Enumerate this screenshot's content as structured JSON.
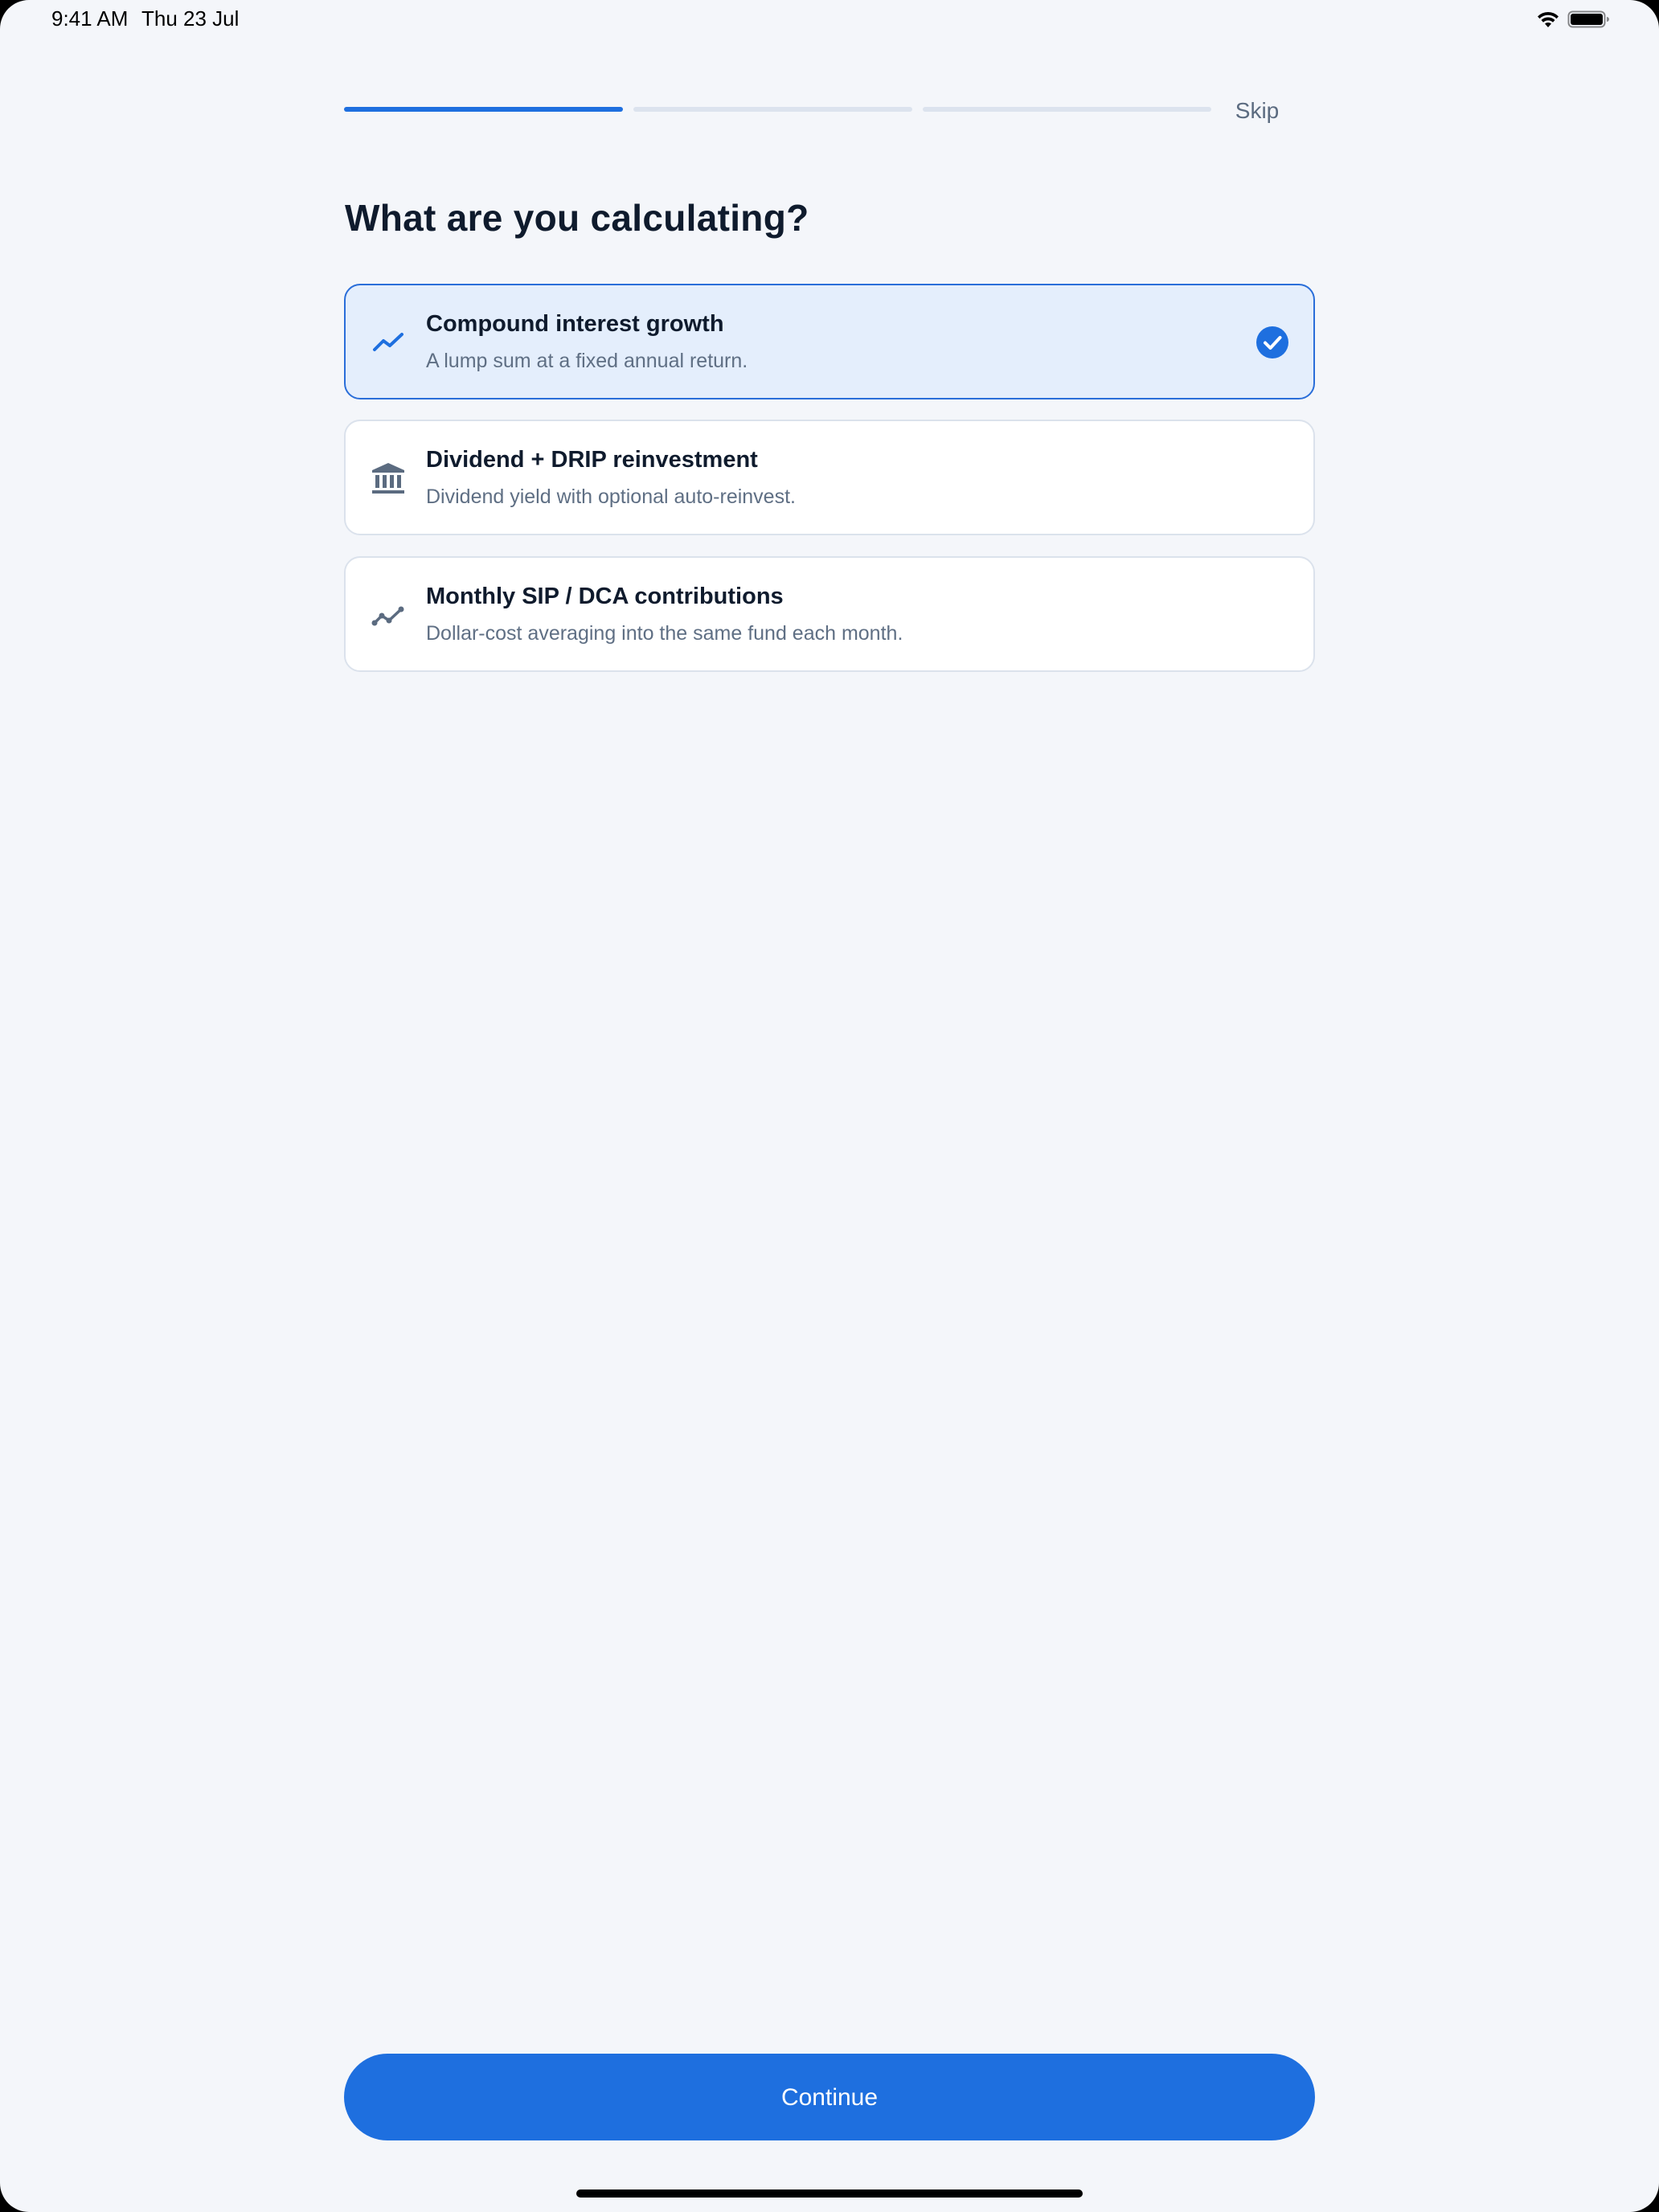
{
  "status_bar": {
    "time": "9:41 AM",
    "date": "Thu 23 Jul",
    "icons": [
      "wifi-icon",
      "battery-icon"
    ]
  },
  "progress": {
    "total_steps": 3,
    "current_step": 1
  },
  "header": {
    "skip_label": "Skip"
  },
  "page": {
    "title": "What are you calculating?"
  },
  "options": [
    {
      "title": "Compound interest growth",
      "description": "A lump sum at a fixed annual return.",
      "icon": "trending-up-icon",
      "selected": true
    },
    {
      "title": "Dividend + DRIP reinvestment",
      "description": "Dividend yield with optional auto-reinvest.",
      "icon": "bank-icon",
      "selected": false
    },
    {
      "title": "Monthly SIP / DCA contributions",
      "description": "Dollar-cost averaging into the same fund each month.",
      "icon": "line-chart-icon",
      "selected": false
    }
  ],
  "footer": {
    "continue_label": "Continue"
  },
  "colors": {
    "accent": "#1e6fdf",
    "selected_bg": "#e4eefc",
    "background": "#f4f6fa",
    "muted_text": "#5f6f84",
    "title_text": "#0f1b2d"
  }
}
